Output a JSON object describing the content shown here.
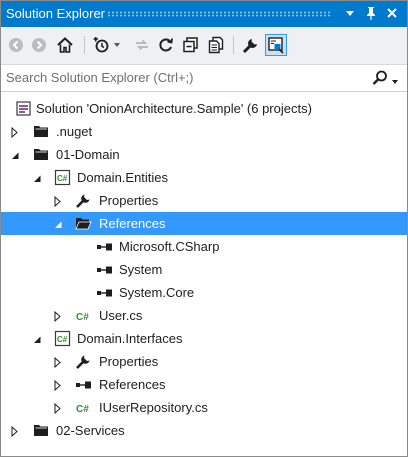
{
  "window": {
    "title": "Solution Explorer",
    "pin_glyph": "▾",
    "autohide_glyph": "ᛘ",
    "close_glyph": "✕"
  },
  "toolbar": {
    "icons": [
      "back-icon",
      "forward-icon",
      "home-icon",
      "pending-changes-filter-icon",
      "sync-with-active-document-icon",
      "refresh-icon",
      "collapse-all-icon",
      "show-all-files-icon",
      "properties-icon",
      "preview-selected-items-icon"
    ]
  },
  "search": {
    "placeholder": "Search Solution Explorer (Ctrl+;)",
    "icon": "search-icon"
  },
  "tree": {
    "rows": [
      {
        "label": "Solution 'OnionArchitecture.Sample' (6 projects)",
        "icon": "solution-icon",
        "expander": "none"
      },
      {
        "label": ".nuget",
        "icon": "folder-icon",
        "expander": "collapsed"
      },
      {
        "label": "01-Domain",
        "icon": "folder-icon",
        "expander": "expanded"
      },
      {
        "label": "Domain.Entities",
        "icon": "csharp-project-icon",
        "expander": "expanded"
      },
      {
        "label": "Properties",
        "icon": "wrench-icon",
        "expander": "collapsed"
      },
      {
        "label": "References",
        "icon": "folder-open-icon",
        "expander": "expanded",
        "selected": true
      },
      {
        "label": "Microsoft.CSharp",
        "icon": "reference-icon",
        "expander": "none"
      },
      {
        "label": "System",
        "icon": "reference-icon",
        "expander": "none"
      },
      {
        "label": "System.Core",
        "icon": "reference-icon",
        "expander": "none"
      },
      {
        "label": "User.cs",
        "icon": "csharp-file-icon",
        "expander": "collapsed"
      },
      {
        "label": "Domain.Interfaces",
        "icon": "csharp-project-icon",
        "expander": "expanded"
      },
      {
        "label": "Properties",
        "icon": "wrench-icon",
        "expander": "collapsed"
      },
      {
        "label": "References",
        "icon": "reference-icon",
        "expander": "collapsed"
      },
      {
        "label": "IUserRepository.cs",
        "icon": "csharp-file-icon",
        "expander": "collapsed"
      },
      {
        "label": "02-Services",
        "icon": "folder-icon",
        "expander": "collapsed"
      }
    ]
  },
  "colors": {
    "accent": "#007acc",
    "selection": "#3399ff",
    "toolbar_bg": "#eef0f4"
  }
}
